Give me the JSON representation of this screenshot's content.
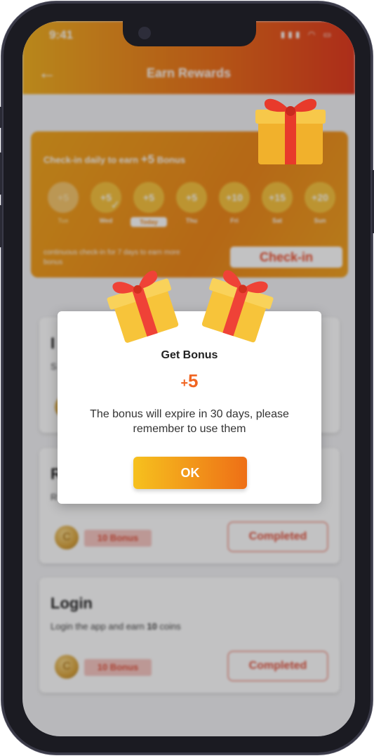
{
  "status_bar": {
    "time": "9:41",
    "icons": "▮▮▮ ◠ ▭"
  },
  "header": {
    "title": "Earn Rewards"
  },
  "checkin": {
    "title_prefix": "Check-in daily to earn ",
    "title_bonus": "+5",
    "title_suffix": " Bonus",
    "days": [
      {
        "value": "+5",
        "label": "Tue"
      },
      {
        "value": "+5",
        "label": "Wed"
      },
      {
        "value": "+5",
        "label": "Today"
      },
      {
        "value": "+5",
        "label": "Thu"
      },
      {
        "value": "+10",
        "label": "Fri"
      },
      {
        "value": "+15",
        "label": "Sat"
      },
      {
        "value": "+20",
        "label": "Sun"
      }
    ],
    "note": "continuous check-in for 7 days to earn more bonus",
    "button_label": "Check-in"
  },
  "tasks": [
    {
      "title": "I",
      "desc": "S",
      "bonus": "",
      "status": ""
    },
    {
      "title": "R",
      "desc": "R",
      "bonus": "10 Bonus",
      "status": "Completed"
    },
    {
      "title": "Login",
      "desc_prefix": "Login the app and earn ",
      "desc_bold": "10",
      "desc_suffix": " coins",
      "bonus": "10 Bonus",
      "status": "Completed"
    }
  ],
  "modal": {
    "title": "Get Bonus",
    "amount_sign": "+",
    "amount_value": "5",
    "message": "The bonus will expire in 30 days, please remember to use them",
    "ok_label": "OK"
  },
  "colors": {
    "accent_orange": "#ee6f16",
    "accent_yellow": "#f6c11e",
    "bonus_red": "#e0503b"
  }
}
